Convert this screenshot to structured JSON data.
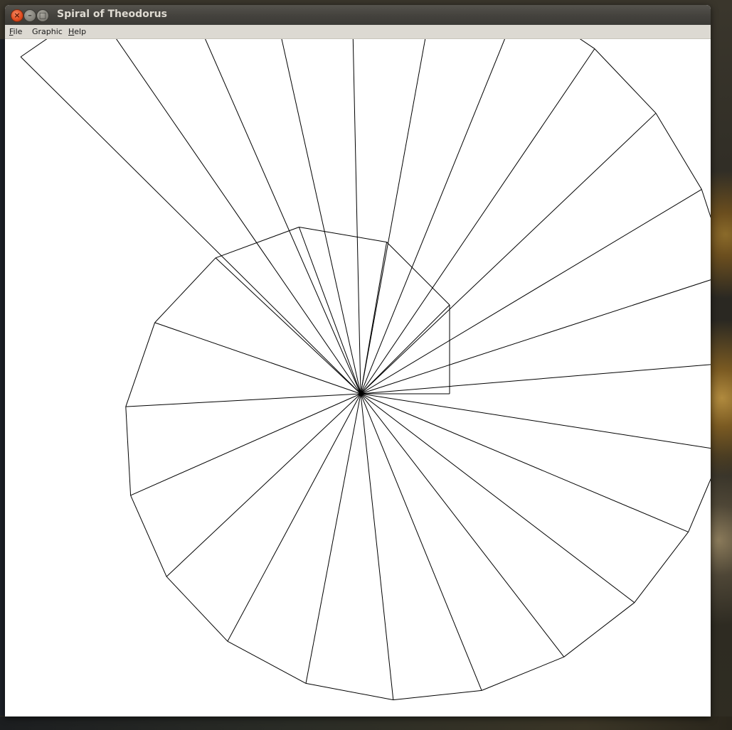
{
  "window": {
    "title": "Spiral of Theodorus",
    "controls": {
      "close_icon": "close-icon",
      "minimize_icon": "minimize-icon",
      "maximize_icon": "maximize-icon"
    }
  },
  "menubar": {
    "items": [
      {
        "mnemonic": "F",
        "rest": "ile"
      },
      {
        "mnemonic": "",
        "rest": "Graphic"
      },
      {
        "mnemonic": "H",
        "rest": "elp"
      }
    ]
  },
  "canvas": {
    "stroke_color": "#000000",
    "background_color": "#ffffff",
    "triangle_count": 28
  }
}
